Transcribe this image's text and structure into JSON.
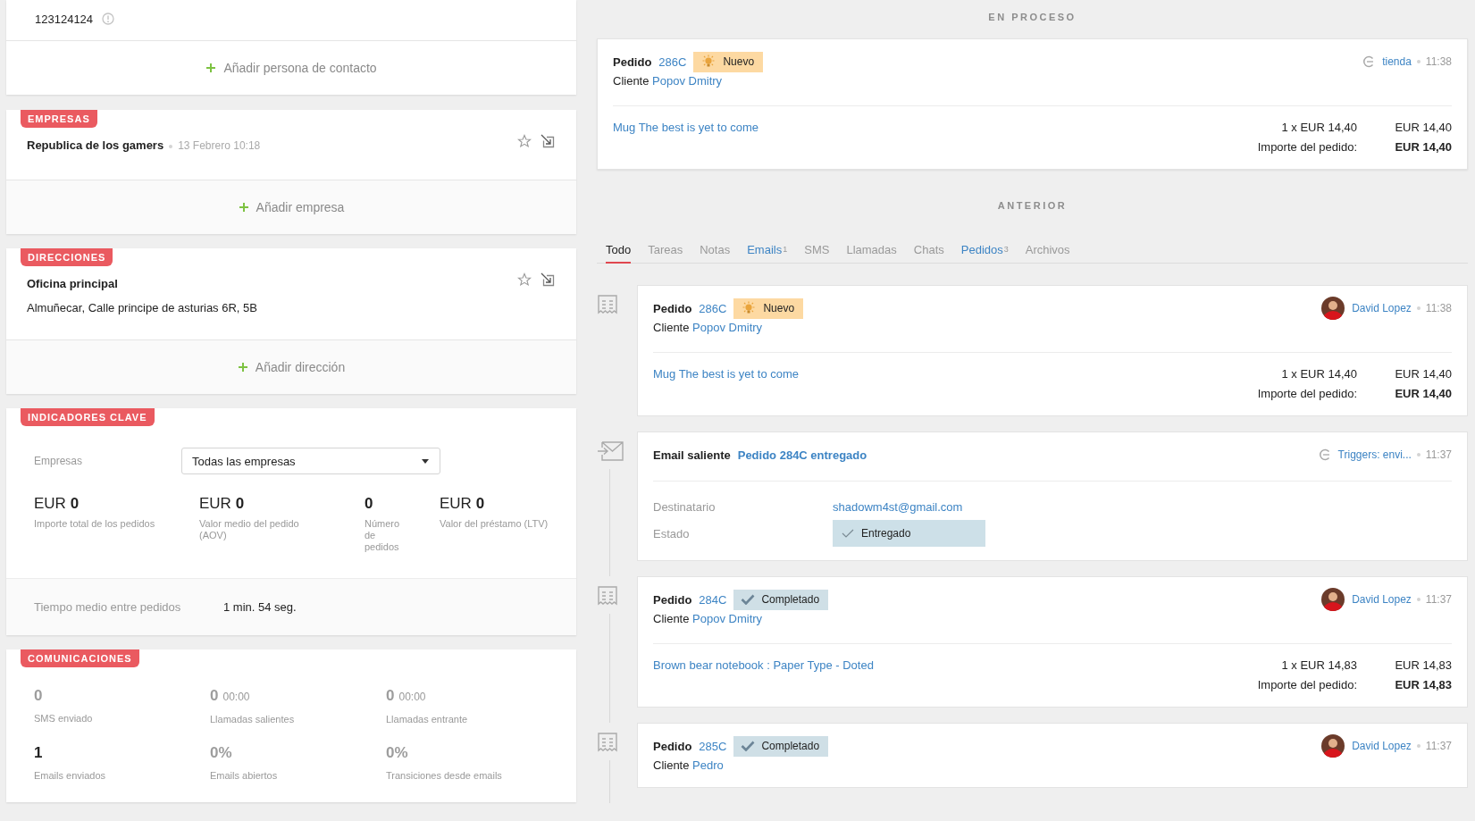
{
  "contact": {
    "phone": "123124124",
    "add_label": "Añadir persona de contacto"
  },
  "companies": {
    "tag": "EMPRESAS",
    "items": [
      {
        "name": "Republica de los gamers",
        "date": "13 Febrero 10:18"
      }
    ],
    "add_label": "Añadir empresa"
  },
  "addresses": {
    "tag": "DIRECCIONES",
    "items": [
      {
        "name": "Oficina principal",
        "address": "Almuñecar, Calle principe de asturias 6R, 5B"
      }
    ],
    "add_label": "Añadir dirección"
  },
  "indicators": {
    "tag": "INDICADORES CLAVE",
    "filter_label": "Empresas",
    "filter_value": "Todas las empresas",
    "metrics": [
      {
        "unit": "EUR",
        "value": "0",
        "label": "Importe total de los pedidos"
      },
      {
        "unit": "EUR",
        "value": "0",
        "label": "Valor medio del pedido (AOV)"
      },
      {
        "value": "0",
        "label": "Número de pedidos"
      },
      {
        "unit": "EUR",
        "value": "0",
        "label": "Valor del préstamo (LTV)"
      }
    ],
    "average": {
      "label": "Tiempo medio entre pedidos",
      "value": "1 min. 54 seg."
    }
  },
  "communications": {
    "tag": "COMUNICACIONES",
    "stats": [
      {
        "value": "0",
        "label": "SMS enviado",
        "muted": true
      },
      {
        "value": "0",
        "extra": "00:00",
        "label": "Llamadas salientes",
        "muted": true
      },
      {
        "value": "0",
        "extra": "00:00",
        "label": "Llamadas entrante",
        "muted": true
      },
      {
        "value": "1",
        "label": "Emails enviados",
        "muted": false
      },
      {
        "value": "0%",
        "label": "Emails abiertos",
        "muted": true
      },
      {
        "value": "0%",
        "label": "Transiciones desde emails",
        "muted": true
      }
    ]
  },
  "in_progress": {
    "heading": "EN PROCESO",
    "items": [
      {
        "kind": "order",
        "title": "Pedido",
        "number": "286C",
        "status": {
          "label": "Nuevo",
          "kind": "new"
        },
        "customer_label": "Cliente",
        "customer": "Popov Dmitry",
        "source": {
          "kind": "channel",
          "name": "tienda"
        },
        "time": "11:38",
        "lines": [
          {
            "product": "Mug The best is yet to come",
            "quantity": "1 x EUR 14,40",
            "total": "EUR 14,40"
          }
        ],
        "total_label": "Importe del pedido:",
        "total": "EUR 14,40"
      }
    ]
  },
  "previous": {
    "heading": "ANTERIOR",
    "tabs": [
      {
        "label": "Todo",
        "selected": true
      },
      {
        "label": "Tareas",
        "selected": false
      },
      {
        "label": "Notas",
        "selected": false
      },
      {
        "label": "Emails",
        "count": "1",
        "selected": false
      },
      {
        "label": "SMS",
        "selected": false
      },
      {
        "label": "Llamadas",
        "selected": false
      },
      {
        "label": "Chats",
        "selected": false
      },
      {
        "label": "Pedidos",
        "count": "3",
        "selected": false
      },
      {
        "label": "Archivos",
        "selected": false
      }
    ],
    "items": [
      {
        "kind": "order",
        "title": "Pedido",
        "number": "286C",
        "status": {
          "label": "Nuevo",
          "kind": "new"
        },
        "customer_label": "Cliente",
        "customer": "Popov Dmitry",
        "source": {
          "kind": "user",
          "name": "David Lopez"
        },
        "time": "11:38",
        "lines": [
          {
            "product": "Mug The best is yet to come",
            "quantity": "1 x EUR 14,40",
            "total": "EUR 14,40"
          }
        ],
        "total_label": "Importe del pedido:",
        "total": "EUR 14,40"
      },
      {
        "kind": "email",
        "title": "Email saliente",
        "subject": "Pedido 284C entregado",
        "source": {
          "kind": "channel",
          "name": "Triggers: envi..."
        },
        "time": "11:37",
        "recipient_label": "Destinatario",
        "recipient": "shadowm4st@gmail.com",
        "state_label": "Estado",
        "state": "Entregado"
      },
      {
        "kind": "order",
        "title": "Pedido",
        "number": "284C",
        "status": {
          "label": "Completado",
          "kind": "done"
        },
        "customer_label": "Cliente",
        "customer": "Popov Dmitry",
        "source": {
          "kind": "user",
          "name": "David Lopez"
        },
        "time": "11:37",
        "lines": [
          {
            "product": "Brown bear notebook : Paper Type - Doted",
            "quantity": "1 x EUR 14,83",
            "total": "EUR 14,83"
          }
        ],
        "total_label": "Importe del pedido:",
        "total": "EUR 14,83"
      },
      {
        "kind": "order",
        "title": "Pedido",
        "number": "285C",
        "status": {
          "label": "Completado",
          "kind": "done"
        },
        "customer_label": "Cliente",
        "customer": "Pedro",
        "source": {
          "kind": "user",
          "name": "David Lopez"
        },
        "time": "11:37"
      }
    ]
  }
}
